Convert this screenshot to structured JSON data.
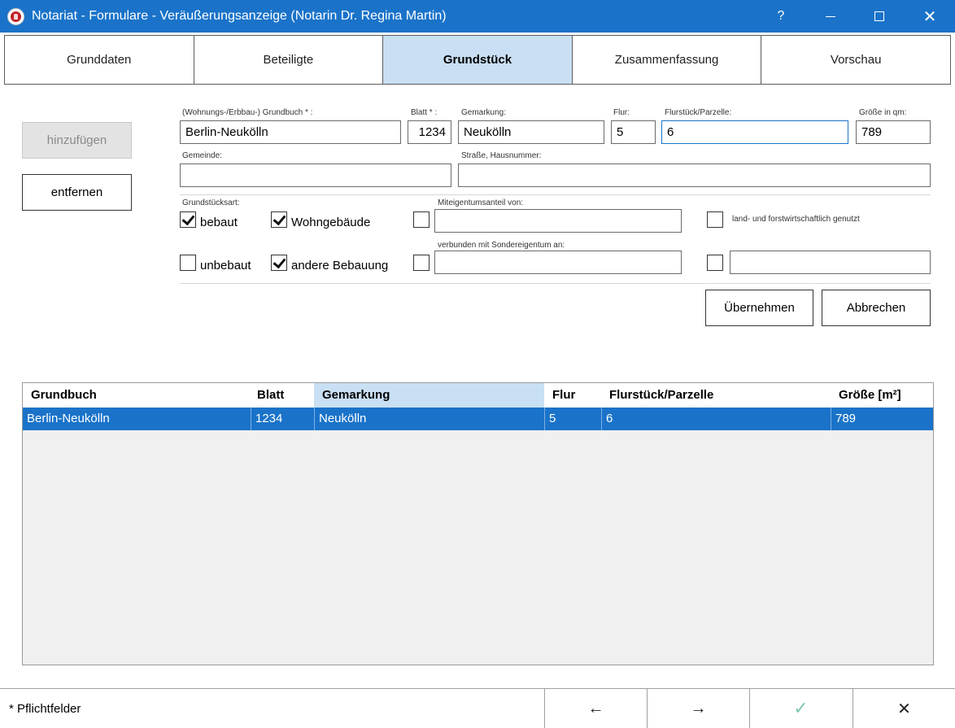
{
  "window": {
    "title": "Notariat - Formulare - Veräußerungsanzeige (Notarin Dr. Regina Martin)",
    "help_label": "?",
    "close_glyph": "✕",
    "icon": "coat-of-arms-icon"
  },
  "tabs": [
    {
      "label": "Grunddaten",
      "active": false
    },
    {
      "label": "Beteiligte",
      "active": false
    },
    {
      "label": "Grundstück",
      "active": true
    },
    {
      "label": "Zusammenfassung",
      "active": false
    },
    {
      "label": "Vorschau",
      "active": false
    }
  ],
  "side": {
    "add_label": "hinzufügen",
    "remove_label": "entfernen"
  },
  "form": {
    "grundbuch": {
      "label": "(Wohnungs-/Erbbau-) Grundbuch * :",
      "value": "Berlin-Neukölln"
    },
    "blatt": {
      "label": "Blatt * :",
      "value": "1234"
    },
    "gemarkung": {
      "label": "Gemarkung:",
      "value": "Neukölln"
    },
    "flur": {
      "label": "Flur:",
      "value": "5"
    },
    "flurstueck": {
      "label": "Flurstück/Parzelle:",
      "value": "6"
    },
    "groesse": {
      "label": "Größe in qm:",
      "value": "789"
    },
    "gemeinde": {
      "label": "Gemeinde:",
      "value": ""
    },
    "strasse": {
      "label": "Straße, Hausnummer:",
      "value": ""
    },
    "grundstuecksart_label": "Grundstücksart:",
    "bebaut": {
      "label": "bebaut",
      "checked": true
    },
    "wohngebaeude": {
      "label": "Wohngebäude",
      "checked": true
    },
    "unbebaut": {
      "label": "unbebaut",
      "checked": false
    },
    "andere_bebauung": {
      "label": "andere Bebauung",
      "checked": true
    },
    "miteigentum": {
      "label": "Miteigentumsanteil von:",
      "checked": false,
      "value": ""
    },
    "sondereigentum": {
      "label": "verbunden mit Sondereigentum an:",
      "checked": false,
      "value": ""
    },
    "landwirtschaft": {
      "label": "land- und forstwirtschaftlich genutzt",
      "checked": false
    },
    "extra": {
      "checked": false,
      "value": ""
    },
    "apply_label": "Übernehmen",
    "cancel_label": "Abbrechen"
  },
  "table": {
    "columns": [
      "Grundbuch",
      "Blatt",
      "Gemarkung",
      "Flur",
      "Flurstück/Parzelle",
      "Größe [m²]"
    ],
    "sorted_column": "Gemarkung",
    "rows": [
      {
        "grundbuch": "Berlin-Neukölln",
        "blatt": "1234",
        "gemarkung": "Neukölln",
        "flur": "5",
        "flurstueck": "6",
        "groesse": "789",
        "selected": true
      }
    ]
  },
  "footer": {
    "note": "* Pflichtfelder",
    "back_glyph": "←",
    "forward_glyph": "→",
    "ok_glyph": "✓",
    "close_glyph": "✕"
  }
}
